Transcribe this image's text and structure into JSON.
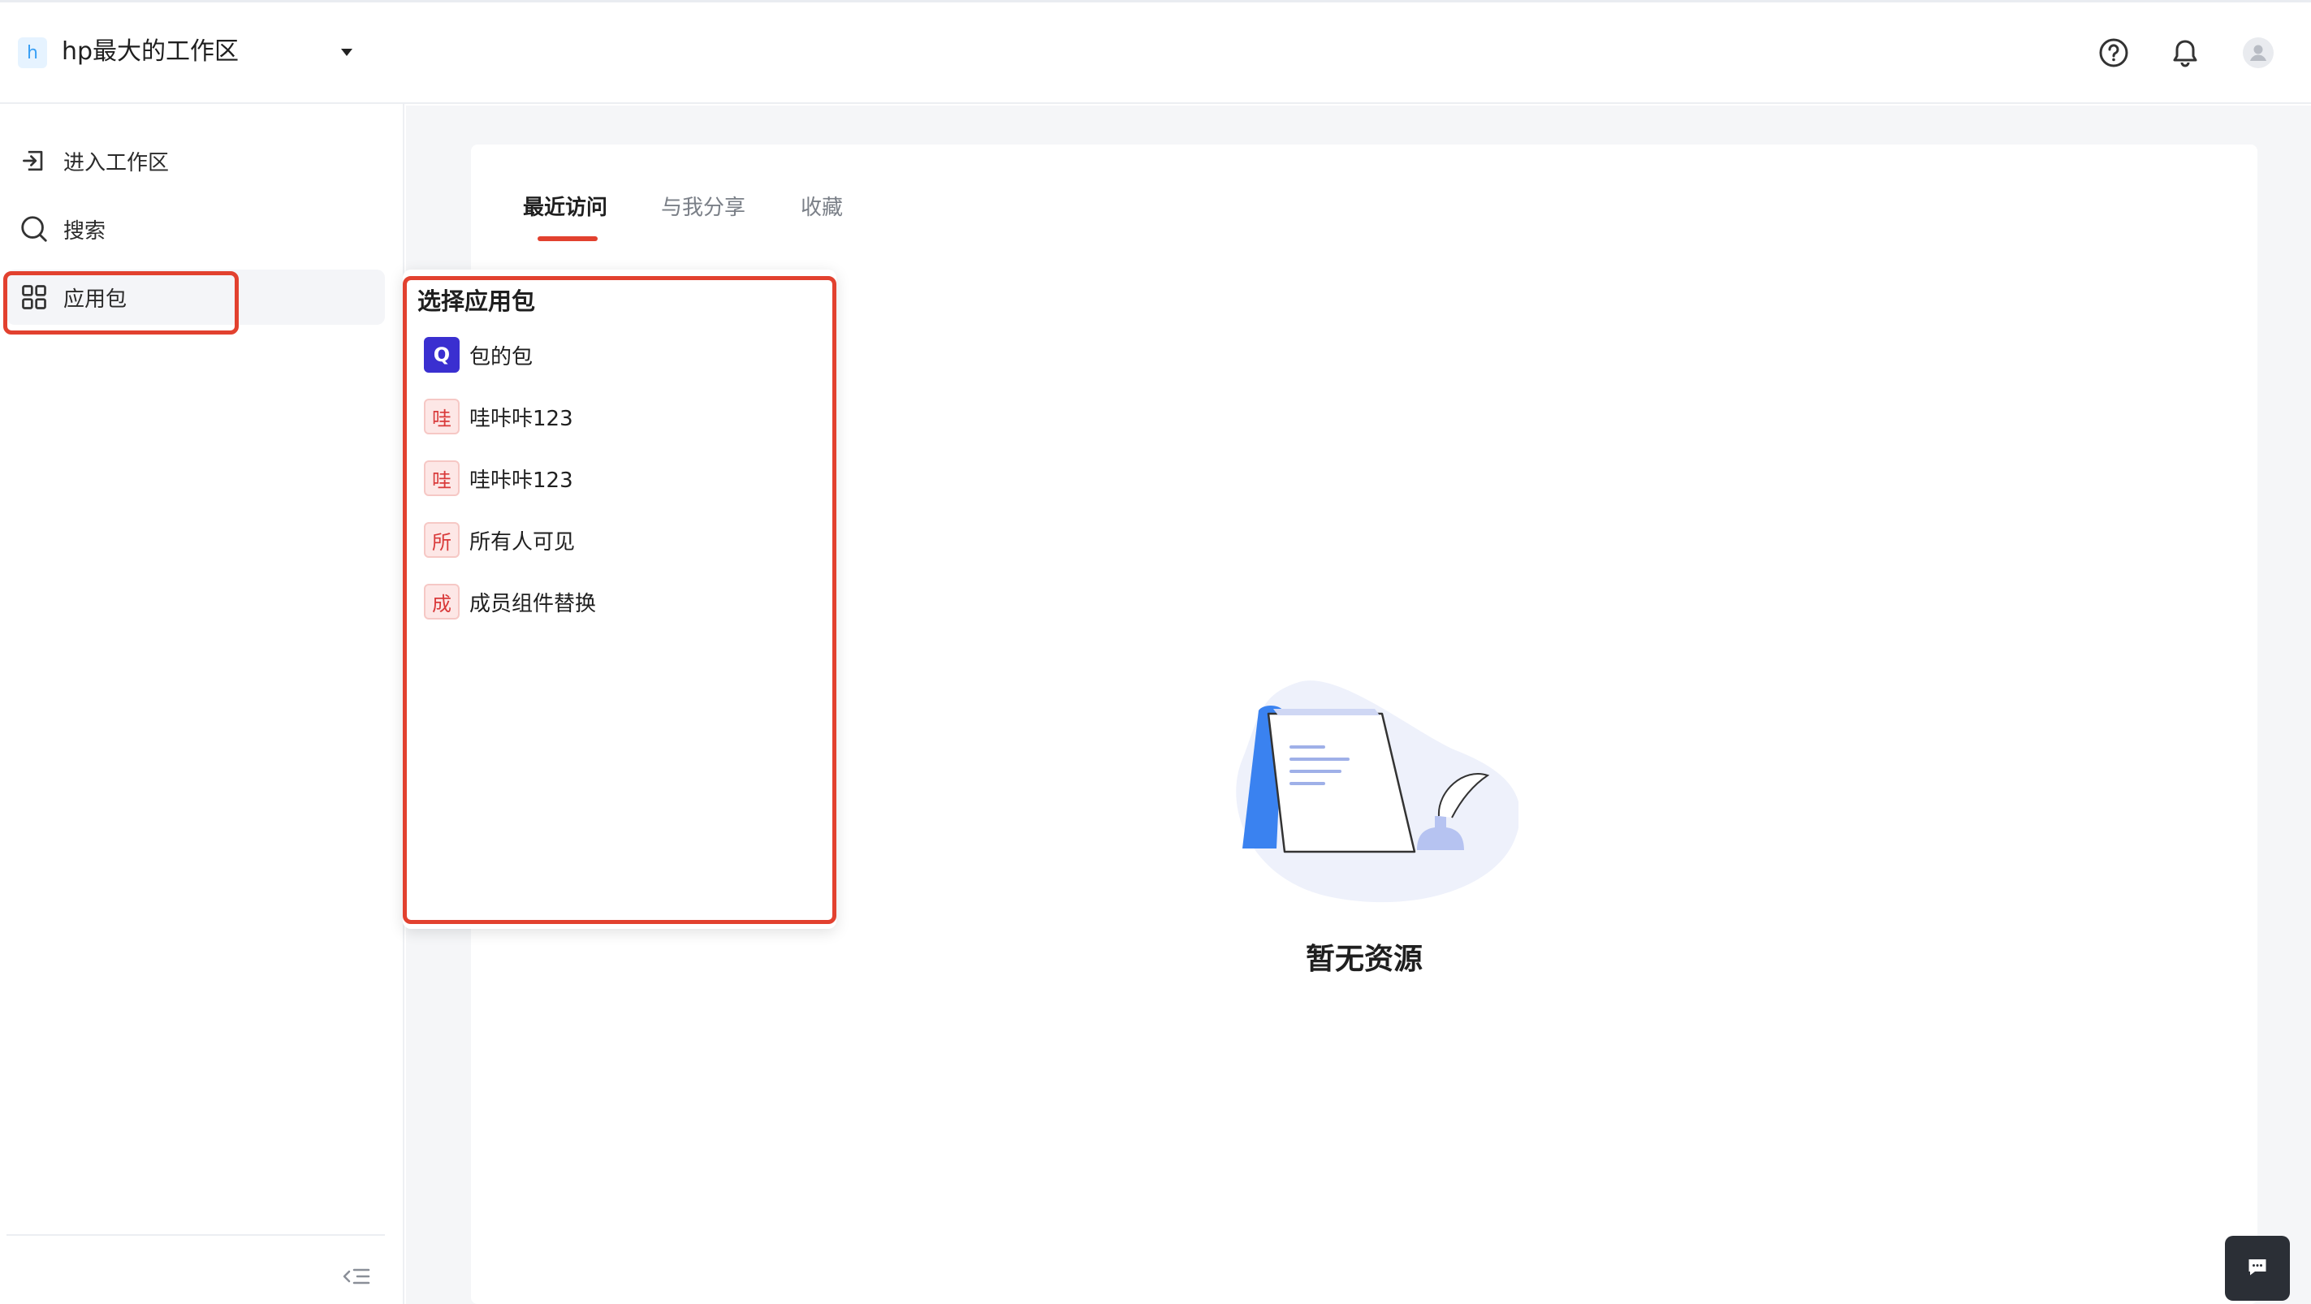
{
  "header": {
    "workspace_badge": "h",
    "workspace_name": "hp最大的工作区",
    "icons": [
      "help-circle-icon",
      "bell-icon",
      "user-avatar-icon"
    ]
  },
  "sidebar": {
    "items": [
      {
        "label": "进入工作区",
        "icon": "enter-workspace-icon"
      },
      {
        "label": "搜索",
        "icon": "search-icon"
      },
      {
        "label": "应用包",
        "icon": "app-grid-icon",
        "active": true
      }
    ],
    "collapse_icon": "collapse-sidebar-icon"
  },
  "main": {
    "tabs": [
      {
        "label": "最近访问",
        "active": true
      },
      {
        "label": "与我分享"
      },
      {
        "label": "收藏"
      }
    ],
    "empty_text": "暂无资源"
  },
  "popover": {
    "title": "选择应用包",
    "items": [
      {
        "badge": "Q",
        "label": "包的包",
        "badge_style": "logo"
      },
      {
        "badge": "哇",
        "label": "哇咔咔123"
      },
      {
        "badge": "哇",
        "label": "哇咔咔123"
      },
      {
        "badge": "所",
        "label": "所有人可见"
      },
      {
        "badge": "成",
        "label": "成员组件替换"
      }
    ]
  },
  "colors": {
    "accent": "#e2412f",
    "highlight_border": "#e2412f",
    "badge_bg": "#fde7e6",
    "badge_text": "#d93a3a",
    "logo_bg": "#3a2fd0",
    "content_bg": "#f5f6f8"
  },
  "chat_icon": "chat-bubble-icon"
}
